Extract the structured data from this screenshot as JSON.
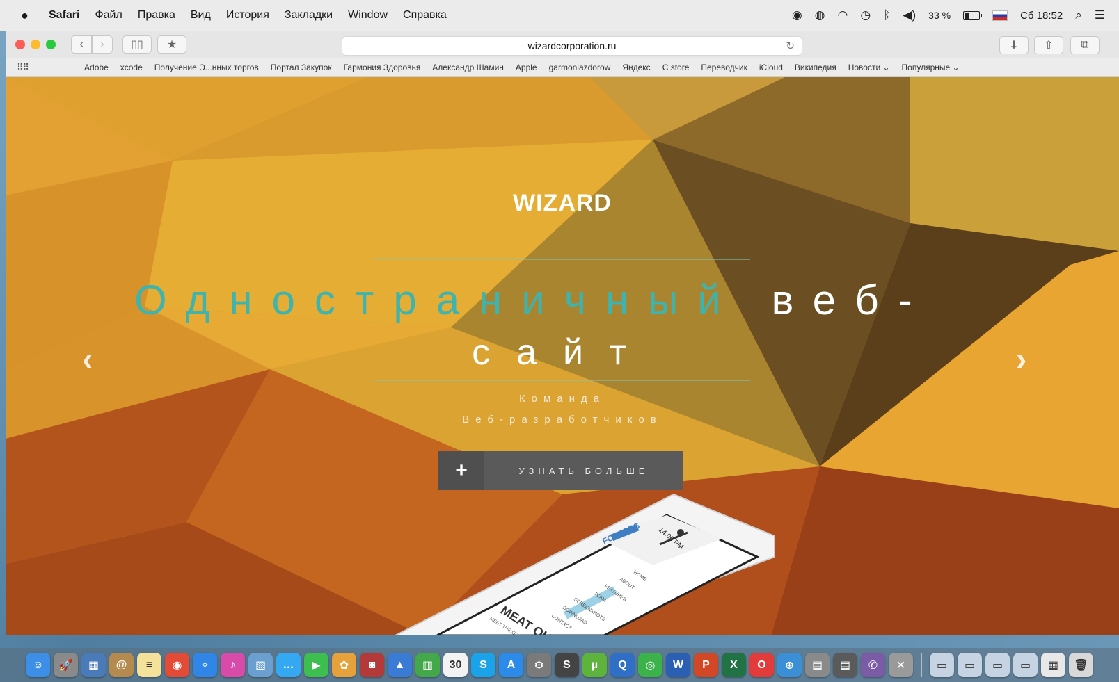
{
  "menubar": {
    "app_name": "Safari",
    "items": [
      "Файл",
      "Правка",
      "Вид",
      "История",
      "Закладки",
      "Window",
      "Справка"
    ],
    "battery": "33 %",
    "clock": "Сб 18:52"
  },
  "toolbar": {
    "url": "wizardcorporation.ru"
  },
  "favorites": [
    "Adobe",
    "xcode",
    "Получение Э...нных торгов",
    "Портал Закупок",
    "Гармония Здоровья",
    "Александр Шамин",
    "Apple",
    "garmoniazdorow",
    "Яндекс",
    "С store",
    "Переводчик",
    "iCloud",
    "Википедия",
    "Новости ⌄",
    "Популярные ⌄"
  ],
  "hero": {
    "brand": "WIZARD",
    "headline_teal": "Одностраничный",
    "headline_white": "веб-",
    "headline_line2": "сайт",
    "subtitle1": "Команда",
    "subtitle2": "Веб-разработчиков",
    "cta_label": "УЗНАТЬ БОЛЬШЕ",
    "cta_icon": "+",
    "prev_arrow": "‹",
    "next_arrow": "›"
  },
  "phone": {
    "time": "14:06 PM",
    "logo": "FOXAPPS",
    "menu": [
      "HOME",
      "ABOUT",
      "FEATURES",
      "TEAM",
      "SCREENSHOTS",
      "DOWNLOAD",
      "CONTACT"
    ],
    "heading": "MEAT OU",
    "sub": "MEET THE GREAT P"
  },
  "colors": {
    "accent_teal": "#3fb3ad",
    "cta_bg": "#5a5a5a",
    "hero_base": "#d48d28"
  },
  "dock": [
    {
      "name": "finder-icon",
      "glyph": "☺",
      "color": "#3d8ee6"
    },
    {
      "name": "launchpad-icon",
      "glyph": "🚀",
      "color": "#8a8a8a"
    },
    {
      "name": "preview-icon",
      "glyph": "▦",
      "color": "#4a7ab8"
    },
    {
      "name": "contacts-icon",
      "glyph": "@",
      "color": "#b58a4e"
    },
    {
      "name": "notes-icon",
      "glyph": "≡",
      "color": "#f4e29a"
    },
    {
      "name": "chrome-icon",
      "glyph": "◉",
      "color": "#e44b36"
    },
    {
      "name": "safari-icon",
      "glyph": "✧",
      "color": "#2f86e6"
    },
    {
      "name": "itunes-icon",
      "glyph": "♪",
      "color": "#d94ba8"
    },
    {
      "name": "photos-app-icon",
      "glyph": "▧",
      "color": "#6a9fcf"
    },
    {
      "name": "messages-icon",
      "glyph": "…",
      "color": "#34a8f0"
    },
    {
      "name": "facetime-icon",
      "glyph": "▶",
      "color": "#3cbf4f"
    },
    {
      "name": "photos-icon",
      "glyph": "✿",
      "color": "#e7a13a"
    },
    {
      "name": "photo-booth-icon",
      "glyph": "◙",
      "color": "#b43a3a"
    },
    {
      "name": "keynote-icon",
      "glyph": "▲",
      "color": "#3a7bd5"
    },
    {
      "name": "numbers-icon",
      "glyph": "▥",
      "color": "#43a84a"
    },
    {
      "name": "calendar-icon",
      "glyph": "30",
      "color": "#f3f3f3"
    },
    {
      "name": "skype-icon",
      "glyph": "S",
      "color": "#1aa3e8"
    },
    {
      "name": "app-store-icon",
      "glyph": "A",
      "color": "#2c8ae8"
    },
    {
      "name": "system-preferences-icon",
      "glyph": "⚙",
      "color": "#7a7a7a"
    },
    {
      "name": "sublime-icon",
      "glyph": "S",
      "color": "#444"
    },
    {
      "name": "utorrent-icon",
      "glyph": "µ",
      "color": "#5db33c"
    },
    {
      "name": "quicktime-icon",
      "glyph": "Q",
      "color": "#2f6fc5"
    },
    {
      "name": "podcast-icon",
      "glyph": "◎",
      "color": "#3bb34a"
    },
    {
      "name": "word-icon",
      "glyph": "W",
      "color": "#2b5fb4"
    },
    {
      "name": "powerpoint-icon",
      "glyph": "P",
      "color": "#d24726"
    },
    {
      "name": "excel-icon",
      "glyph": "X",
      "color": "#217346"
    },
    {
      "name": "opera-icon",
      "glyph": "O",
      "color": "#e23b3b"
    },
    {
      "name": "network-icon",
      "glyph": "⊕",
      "color": "#3b8fd6"
    },
    {
      "name": "printer-icon",
      "glyph": "▤",
      "color": "#8a8a8a"
    },
    {
      "name": "printer2-icon",
      "glyph": "▤",
      "color": "#5a5a5a"
    },
    {
      "name": "viber-icon",
      "glyph": "✆",
      "color": "#7b5aa6"
    },
    {
      "name": "utilities-icon",
      "glyph": "✕",
      "color": "#9a9a9a"
    },
    {
      "name": "folder-docs-icon",
      "glyph": "▭",
      "color": "#c5d3e2"
    },
    {
      "name": "folder-downloads-icon",
      "glyph": "▭",
      "color": "#c5d3e2"
    },
    {
      "name": "folder-apps-icon",
      "glyph": "▭",
      "color": "#c5d3e2"
    },
    {
      "name": "folder-stack-icon",
      "glyph": "▭",
      "color": "#c5d3e2"
    },
    {
      "name": "screenshots-icon",
      "glyph": "▦",
      "color": "#e8e8e8"
    },
    {
      "name": "trash-icon",
      "glyph": "🗑",
      "color": "#d8d8d8"
    }
  ]
}
